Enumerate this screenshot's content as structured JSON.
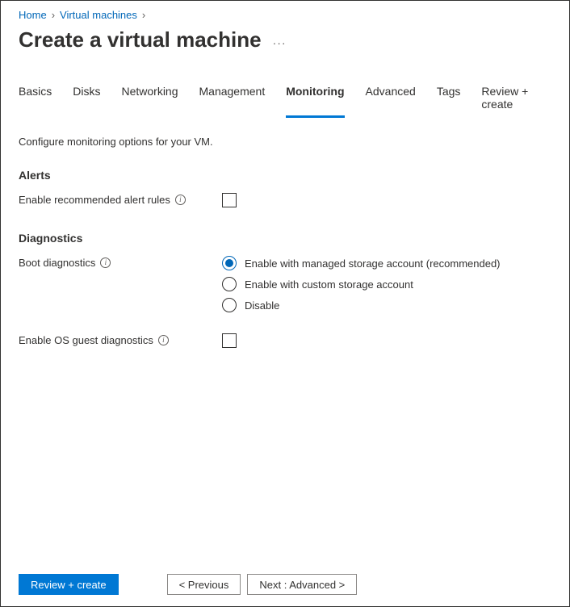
{
  "breadcrumb": {
    "home": "Home",
    "vms": "Virtual machines"
  },
  "title": "Create a virtual machine",
  "tabs": {
    "basics": "Basics",
    "disks": "Disks",
    "networking": "Networking",
    "management": "Management",
    "monitoring": "Monitoring",
    "advanced": "Advanced",
    "tags": "Tags",
    "review": "Review + create"
  },
  "intro": "Configure monitoring options for your VM.",
  "alertsSection": {
    "heading": "Alerts",
    "enableRecommendedLabel": "Enable recommended alert rules"
  },
  "diagnosticsSection": {
    "heading": "Diagnostics",
    "bootLabel": "Boot diagnostics",
    "radioManaged": "Enable with managed storage account (recommended)",
    "radioCustom": "Enable with custom storage account",
    "radioDisable": "Disable",
    "osGuestLabel": "Enable OS guest diagnostics"
  },
  "footer": {
    "review": "Review + create",
    "previous": "< Previous",
    "next": "Next : Advanced >"
  }
}
